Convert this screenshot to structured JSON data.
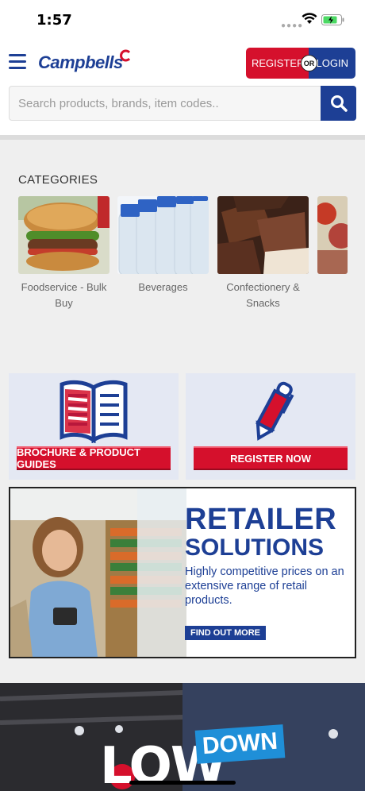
{
  "status": {
    "time": "1:57"
  },
  "header": {
    "logo_text": "Campbells",
    "register_label": "REGISTER",
    "or_label": "OR",
    "login_label": "LOGIN",
    "search_placeholder": "Search products, brands, item codes.."
  },
  "categories": {
    "title": "CATEGORIES",
    "items": [
      {
        "label": "Foodservice - Bulk Buy"
      },
      {
        "label": "Beverages"
      },
      {
        "label": "Confectionery & Snacks"
      }
    ]
  },
  "promos": {
    "brochure_label": "BROCHURE & PRODUCT GUIDES",
    "register_label": "REGISTER NOW"
  },
  "banner": {
    "heading1": "RETAILER",
    "heading2": "SOLUTIONS",
    "body": "Highly competitive prices on an extensive range of retail products.",
    "cta": "FIND OUT MORE"
  },
  "lowdown": {
    "word1": "LOW",
    "word2": "DOWN"
  },
  "colors": {
    "brand_blue": "#1d3f95",
    "brand_red": "#d5102c"
  }
}
